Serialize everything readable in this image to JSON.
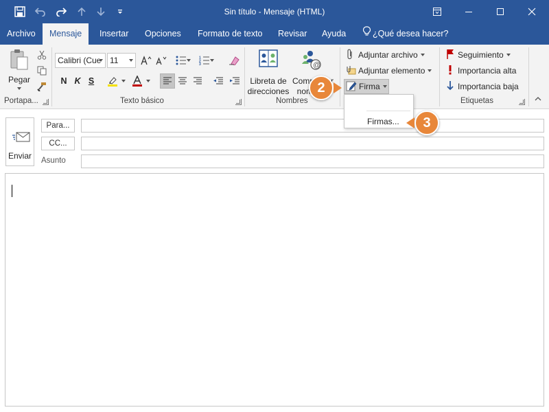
{
  "window": {
    "title": "Sin título  -  Mensaje (HTML)"
  },
  "tabs": [
    {
      "label": "Archivo"
    },
    {
      "label": "Mensaje"
    },
    {
      "label": "Insertar"
    },
    {
      "label": "Opciones"
    },
    {
      "label": "Formato de texto"
    },
    {
      "label": "Revisar"
    },
    {
      "label": "Ayuda"
    },
    {
      "label": "¿Qué desea hacer?"
    }
  ],
  "ribbon": {
    "clipboard": {
      "paste_label": "Pegar",
      "group_label": "Portapa..."
    },
    "basic_text": {
      "font_name": "Calibri (Cue",
      "font_size": "11",
      "bold": "N",
      "italic": "K",
      "underline": "S",
      "group_label": "Texto básico"
    },
    "names": {
      "address_book_line1": "Libreta de",
      "address_book_line2": "direcciones",
      "check_names_line1": "Comprobar",
      "check_names_line2": "nombres",
      "group_label": "Nombres"
    },
    "include": {
      "attach_file": "Adjuntar archivo",
      "attach_item": "Adjuntar elemento",
      "signature": "Firma"
    },
    "tags": {
      "follow_up": "Seguimiento",
      "high_importance": "Importancia alta",
      "low_importance": "Importancia baja",
      "group_label": "Etiquetas"
    }
  },
  "signature_dropdown": {
    "item": "Firmas..."
  },
  "callouts": {
    "step2": "2",
    "step3": "3"
  },
  "compose": {
    "send_label": "Enviar",
    "to_label": "Para...",
    "cc_label": "CC...",
    "subject_label": "Asunto",
    "to_value": "",
    "cc_value": "",
    "subject_value": "",
    "body_value": ""
  },
  "colors": {
    "brand_blue": "#2b579a",
    "callout_orange": "#e8873a",
    "ribbon_bg": "#f3f3f3"
  }
}
